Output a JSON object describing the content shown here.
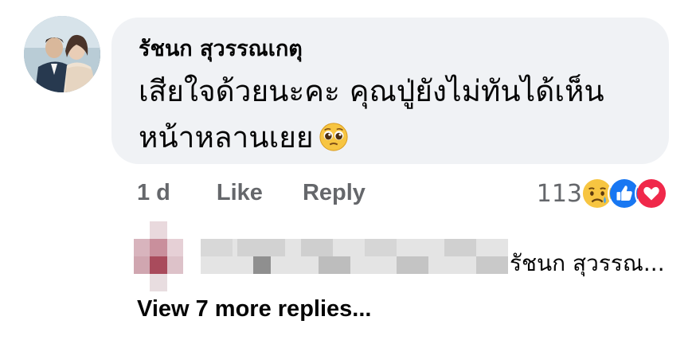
{
  "comment": {
    "author": "รัชนก สุวรรณเกตุ",
    "text": "เสียใจด้วยนะคะ คุณปู่ยังไม่ทันได้เห็นหน้าหลานเยย",
    "emoji": "pleading-face-icon"
  },
  "meta": {
    "time": "1 d",
    "like_label": "Like",
    "reply_label": "Reply",
    "reaction_count": "113",
    "reactions": [
      "sad-face-icon",
      "like-thumb-icon",
      "love-heart-icon"
    ]
  },
  "reply_preview": {
    "author_truncated": "รัชนก สุวรรณ..."
  },
  "view_more_label": "View 7 more replies..."
}
